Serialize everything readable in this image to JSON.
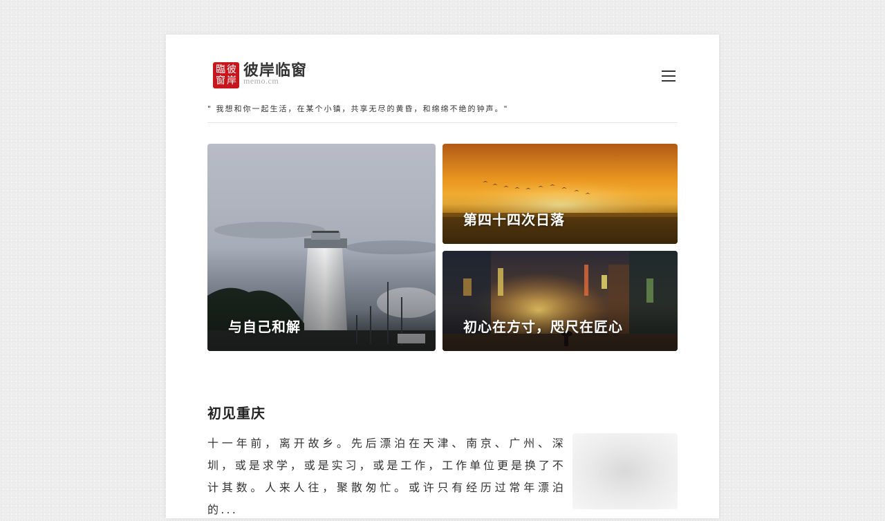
{
  "header": {
    "logo_seal": [
      "臨",
      "彼",
      "窗",
      "岸"
    ],
    "site_title": "彼岸临窗",
    "site_domain": "memo.cm",
    "menu_icon": "hamburger-menu-icon",
    "tagline": "\" 我想和你一起生活，在某个小镇，共享无尽的黄昏，和绵绵不绝的钟声。\""
  },
  "featured": [
    {
      "title": "与自己和解"
    },
    {
      "title": "第四十四次日落"
    },
    {
      "title": "初心在方寸，咫尺在匠心"
    }
  ],
  "article": {
    "title": "初见重庆",
    "excerpt": "十一年前，离开故乡。先后漂泊在天津、南京、广州、深圳，或是求学，或是实习，或是工作，工作单位更是换了不计其数。人来人往，聚散匆忙。或许只有经历过常年漂泊的..."
  },
  "colors": {
    "seal_red": "#c8161d",
    "page_bg": "#eeeeee",
    "card_bg": "#ffffff"
  }
}
